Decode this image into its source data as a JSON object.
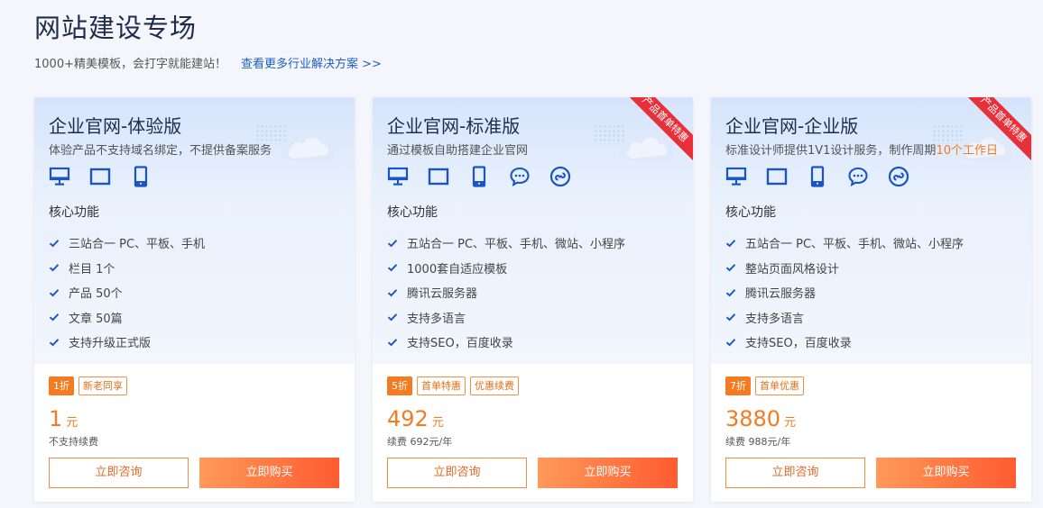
{
  "header": {
    "title": "网站建设专场",
    "subtitle": "1000+精美模板，会打字就能建站！",
    "link": "查看更多行业解决方案 >>"
  },
  "colors": {
    "accent": "#f47b20",
    "ribbon": "#e8303a",
    "icon": "#1a55c2"
  },
  "core_label": "核心功能",
  "plans": [
    {
      "title": "企业官网-体验版",
      "desc": "体验产品不支持域名绑定，不提供备案服务",
      "icons": [
        "desktop-icon",
        "tablet-icon",
        "mobile-icon"
      ],
      "features": [
        "三站合一 PC、平板、手机",
        "栏目 1个",
        "产品 50个",
        "文章 50篇",
        "支持升级正式版"
      ],
      "discount": "1折",
      "tags": [
        "新老同享"
      ],
      "price": "1",
      "unit": "元",
      "renew": "不支持续费",
      "consult": "立即咨询",
      "buy": "立即购买"
    },
    {
      "title": "企业官网-标准版",
      "desc": "通过模板自助搭建企业官网",
      "ribbon": "产品首单特惠",
      "icons": [
        "desktop-icon",
        "tablet-icon",
        "mobile-icon",
        "wechat-icon",
        "miniprogram-icon"
      ],
      "features": [
        "五站合一  PC、平板、手机、微站、小程序",
        "1000套自适应模板",
        "腾讯云服务器",
        "支持多语言",
        "支持SEO，百度收录"
      ],
      "discount": "5折",
      "tags": [
        "首单特惠",
        "优惠续费"
      ],
      "price": "492",
      "unit": "元",
      "renew": "续费 692元/年",
      "consult": "立即咨询",
      "buy": "立即购买"
    },
    {
      "title": "企业官网-企业版",
      "desc": "标准设计师提供1V1设计服务，制作周期",
      "desc_highlight": "10个工作日",
      "ribbon": "产品首单特惠",
      "icons": [
        "desktop-icon",
        "tablet-icon",
        "mobile-icon",
        "wechat-icon",
        "miniprogram-icon"
      ],
      "features": [
        "五站合一  PC、平板、手机、微站、小程序",
        "整站页面风格设计",
        "腾讯云服务器",
        "支持多语言",
        "支持SEO，百度收录"
      ],
      "discount": "7折",
      "tags": [
        "首单优惠"
      ],
      "price": "3880",
      "unit": "元",
      "renew": "续费 988元/年",
      "consult": "立即咨询",
      "buy": "立即购买"
    }
  ]
}
